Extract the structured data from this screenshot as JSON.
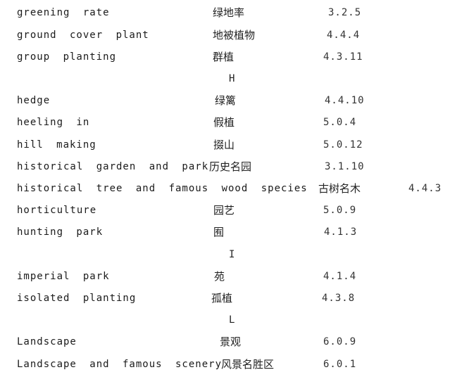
{
  "glossary": {
    "entries": [
      {
        "en": "greening rate",
        "cn": "绿地率",
        "code": "3.2.5"
      },
      {
        "en": "ground cover plant",
        "cn": "地被植物",
        "code": "4.4.4"
      },
      {
        "en": "group planting",
        "cn": "群植",
        "code": "4.3.11"
      },
      {
        "heading": "H"
      },
      {
        "en": "hedge",
        "cn": "绿篱",
        "code": "4.4.10"
      },
      {
        "en": "heeling in",
        "cn": "假植",
        "code": "5.0.4"
      },
      {
        "en": "hill making",
        "cn": "掇山",
        "code": "5.0.12"
      },
      {
        "en": "historical garden and park",
        "cn": "历史名园",
        "code": "3.1.10"
      },
      {
        "en": "historical tree and famous wood species",
        "cn": "古树名木",
        "code": "4.4.3"
      },
      {
        "en": "horticulture",
        "cn": "园艺",
        "code": "5.0.9"
      },
      {
        "en": "hunting park",
        "cn": "囿",
        "code": "4.1.3"
      },
      {
        "heading": "I"
      },
      {
        "en": "imperial park",
        "cn": "苑",
        "code": "4.1.4"
      },
      {
        "en": "isolated planting",
        "cn": "孤植",
        "code": "4.3.8"
      },
      {
        "heading": "L"
      },
      {
        "en": "Landscape",
        "cn": "景观",
        "code": "6.0.9"
      },
      {
        "en": "Landscape and famous scenery",
        "cn": "风景名胜区",
        "code": "6.0.1"
      }
    ]
  }
}
